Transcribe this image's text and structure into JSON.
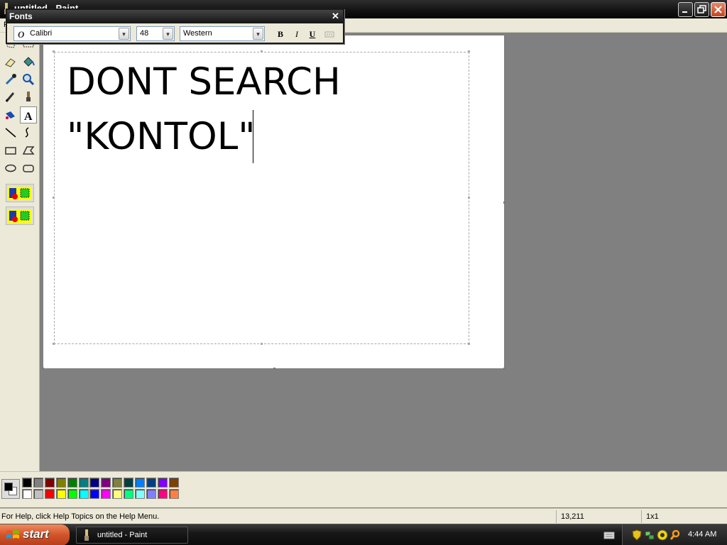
{
  "window": {
    "title": "untitled - Paint",
    "menu": {
      "file_label": "F"
    }
  },
  "fonts_toolbar": {
    "title": "Fonts",
    "close_glyph": "✕",
    "font_name": "Calibri",
    "font_size": "48",
    "script": "Western",
    "bold_label": "B",
    "italic_label": "I",
    "underline_label": "U",
    "dropdown_glyph": "▾"
  },
  "canvas": {
    "text_lines": [
      "DONT SEARCH",
      "\"KONTOL\""
    ]
  },
  "palette": {
    "foreground": "#000000",
    "background": "#ffffff",
    "top_row": [
      "#000000",
      "#808080",
      "#800000",
      "#808000",
      "#008000",
      "#008080",
      "#000080",
      "#800080",
      "#808040",
      "#004040",
      "#0080ff",
      "#004080",
      "#8000ff",
      "#804000"
    ],
    "bottom_row": [
      "#ffffff",
      "#c0c0c0",
      "#ff0000",
      "#ffff00",
      "#00ff00",
      "#00ffff",
      "#0000ff",
      "#ff00ff",
      "#ffff80",
      "#00ff80",
      "#80ffff",
      "#8080ff",
      "#ff0080",
      "#ff8040"
    ]
  },
  "status": {
    "help_text": "For Help, click Help Topics on the Help Menu.",
    "coordinates": "13,211",
    "size": "1x1"
  },
  "taskbar": {
    "start_label": "start",
    "task_label": "untitled - Paint",
    "clock": "4:44 AM"
  },
  "icons": {
    "tools": [
      "free-form-select",
      "rect-select",
      "eraser",
      "fill",
      "pick-color",
      "magnifier",
      "pencil",
      "brush",
      "airbrush",
      "text",
      "line",
      "curve",
      "rectangle",
      "polygon",
      "ellipse",
      "rounded-rectangle"
    ],
    "tray": [
      "shield-icon",
      "network-icon",
      "sound-icon",
      "search-icon"
    ]
  },
  "colors": {
    "taskbar_start": "#d2532a",
    "title_bar": "#151515"
  }
}
